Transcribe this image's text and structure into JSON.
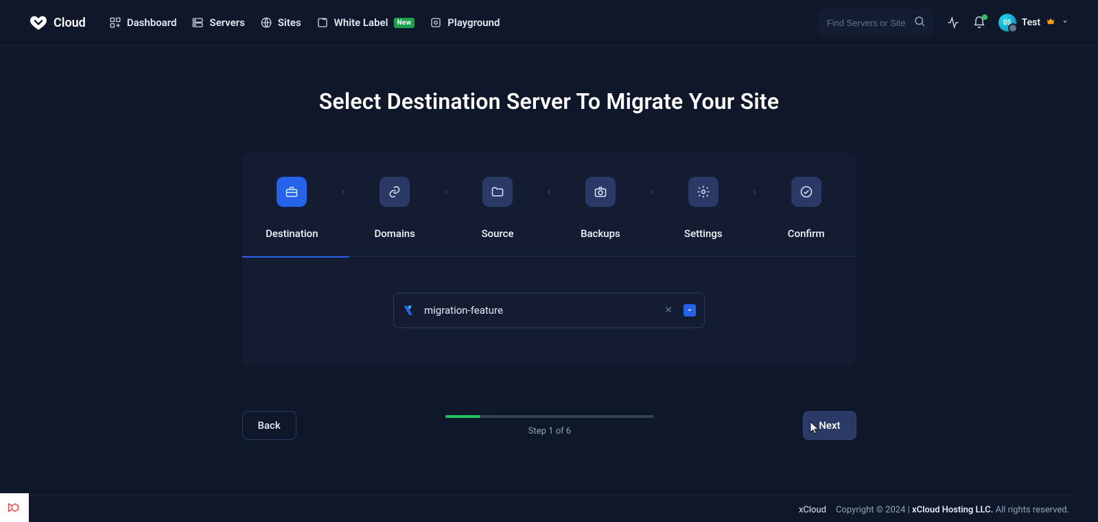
{
  "brand": "Cloud",
  "nav": {
    "dashboard": "Dashboard",
    "servers": "Servers",
    "sites": "Sites",
    "white_label": "White Label",
    "white_label_badge": "New",
    "playground": "Playground"
  },
  "search": {
    "placeholder": "Find Servers or Sites"
  },
  "user": {
    "initials": "05",
    "name": "Test"
  },
  "page": {
    "title": "Select Destination Server To Migrate Your Site",
    "steps": [
      {
        "label": "Destination"
      },
      {
        "label": "Domains"
      },
      {
        "label": "Source"
      },
      {
        "label": "Backups"
      },
      {
        "label": "Settings"
      },
      {
        "label": "Confirm"
      }
    ],
    "selected_server": "migration-feature",
    "back_label": "Back",
    "next_label": "Next",
    "progress_text": "Step 1 of 6"
  },
  "footer": {
    "brand": "xCloud",
    "copyright_prefix": "Copyright © 2024 | ",
    "company": "xCloud Hosting LLC.",
    "rights": " All rights reserved."
  }
}
